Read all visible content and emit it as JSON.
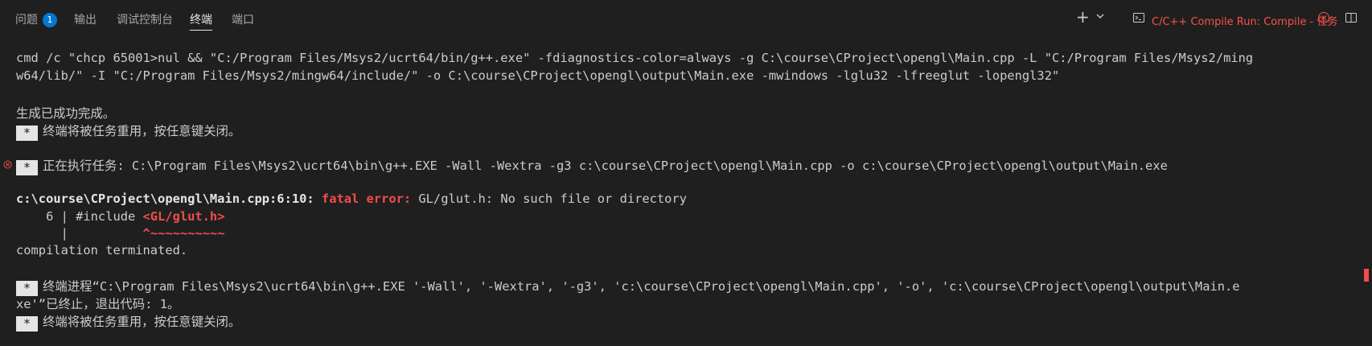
{
  "tabs": [
    {
      "label": "问题",
      "badge": "1"
    },
    {
      "label": "输出"
    },
    {
      "label": "调试控制台"
    },
    {
      "label": "终端"
    },
    {
      "label": "端口"
    }
  ],
  "toolbar": {
    "add_icon": "plus-icon",
    "dropdown_icon": "chevron-down-icon",
    "task_icon": "terminal-icon",
    "task_label": "C/C++ Compile Run: Compile - 任务",
    "close_icon": "close-icon",
    "layout_icon": "split-panel-icon"
  },
  "terminal": {
    "cmd1": "cmd /c \"chcp 65001>nul && \"C:/Program Files/Msys2/ucrt64/bin/g++.exe\" -fdiagnostics-color=always -g C:\\course\\CProject\\opengl\\Main.cpp -L \"C:/Program Files/Msys2/ming",
    "cmd2": "w64/lib/\" -I \"C:/Program Files/Msys2/mingw64/include/\" -o C:\\course\\CProject\\opengl\\output\\Main.exe -mwindows -lglu32 -lfreeglut -lopengl32\"",
    "success": "生成已成功完成。",
    "star": "*",
    "reuse1": "终端将被任务重用，按任意键关闭。",
    "running": "正在执行任务: C:\\Program Files\\Msys2\\ucrt64\\bin\\g++.EXE -Wall -Wextra -g3 c:\\course\\CProject\\opengl\\Main.cpp -o c:\\course\\CProject\\opengl\\output\\Main.exe",
    "err_loc": "c:\\course\\CProject\\opengl\\Main.cpp:6:10:",
    "err_kw": "fatal error:",
    "err_msg": " GL/glut.h: No such file or directory",
    "src_prefix": "    6 | #include ",
    "src_hl": "<GL/glut.h>",
    "caret_prefix": "      |          ",
    "caret": "^~~~~~~~~~~",
    "terminated": "compilation terminated.",
    "exit1": "终端进程“C:\\Program Files\\Msys2\\ucrt64\\bin\\g++.EXE '-Wall', '-Wextra', '-g3', 'c:\\course\\CProject\\opengl\\Main.cpp', '-o', 'c:\\course\\CProject\\opengl\\output\\Main.e",
    "exit2": "xe'”已终止，退出代码: 1。",
    "reuse2": "终端将被任务重用，按任意键关闭。"
  }
}
